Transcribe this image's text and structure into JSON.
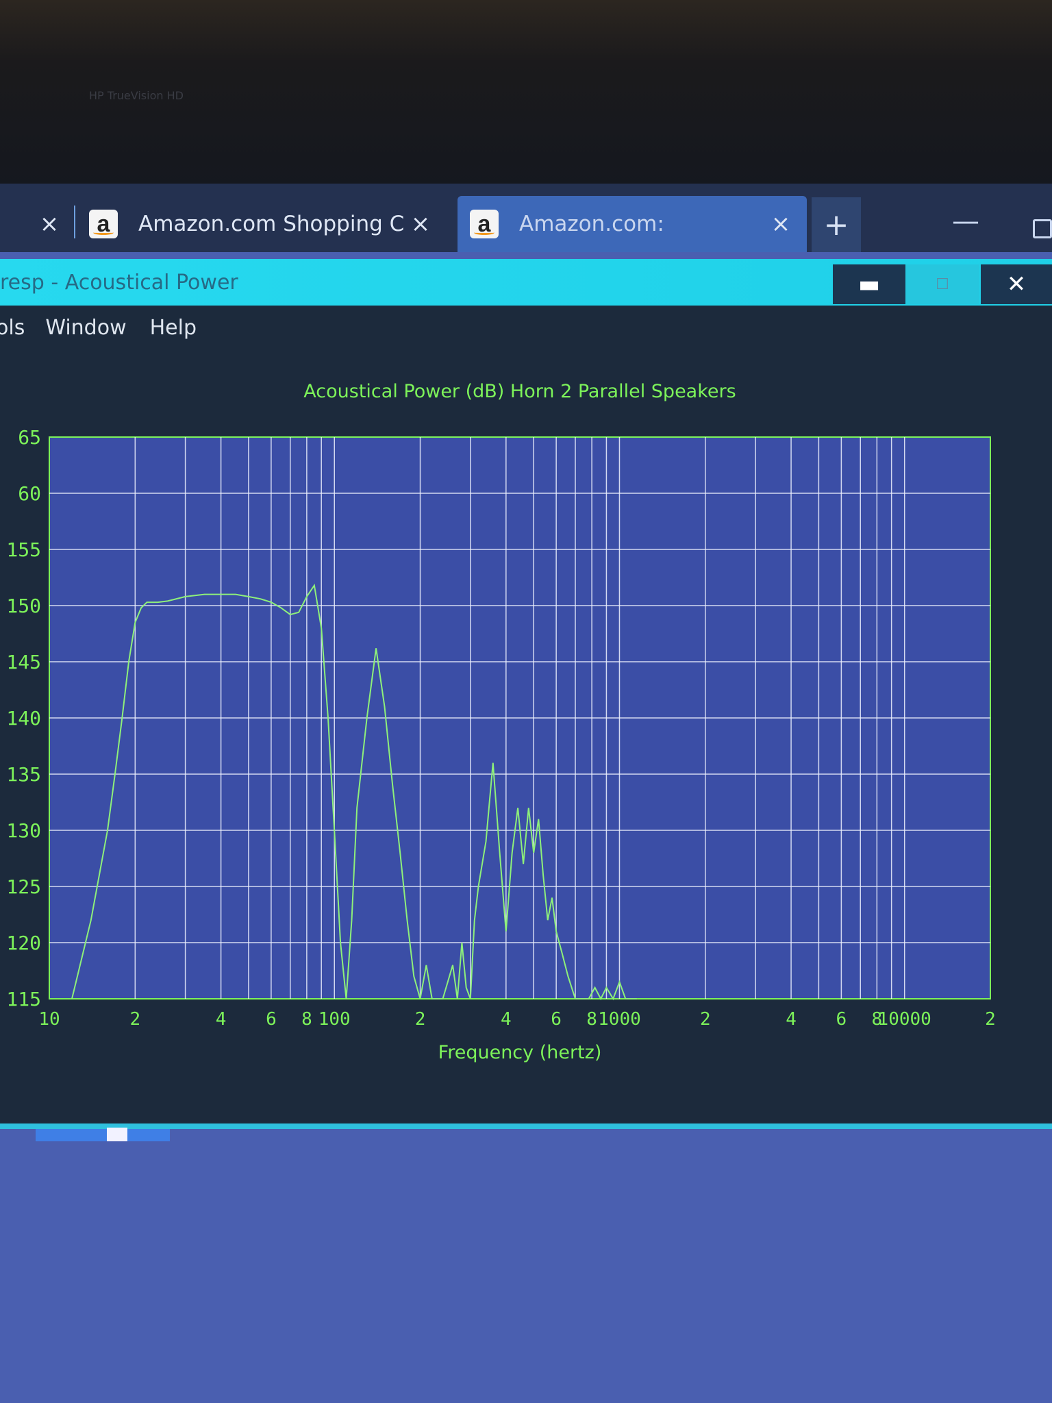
{
  "bezel": {
    "webcam_label": "HP TrueVision HD"
  },
  "browser": {
    "tabs": [
      {
        "title": "",
        "active": false
      },
      {
        "title": "Amazon.com Shopping C",
        "favicon": "amazon-icon",
        "active": false
      },
      {
        "title": "Amazon.com:",
        "favicon": "amazon-icon",
        "active": true
      }
    ],
    "favicon_letter": "a",
    "new_tab_symbol": "+",
    "close_symbol": "×",
    "minimize_symbol": "—"
  },
  "window": {
    "title": "resp - Acoustical Power",
    "minimize_symbol": "▬",
    "maximize_symbol": "☐",
    "close_symbol": "✕",
    "menu": [
      "ols",
      "Window",
      "Help"
    ]
  },
  "colors": {
    "plot_line": "#8ef07a",
    "plot_text": "#7df35a",
    "grid": "#eef2ff",
    "plot_bg": "#3b4ea6",
    "titlebar": "#22d4ec"
  },
  "chart_data": {
    "type": "line",
    "title": "Acoustical Power (dB)   Horn   2 Parallel Speakers",
    "xlabel": "Frequency (hertz)",
    "ylabel": "",
    "x_scale": "log",
    "xlim": [
      10,
      20000
    ],
    "ylim": [
      115,
      165
    ],
    "grid": true,
    "x_tick_labels": [
      {
        "value": 10,
        "label": "10"
      },
      {
        "value": 20,
        "label": "2"
      },
      {
        "value": 40,
        "label": "4"
      },
      {
        "value": 60,
        "label": "6"
      },
      {
        "value": 80,
        "label": "8"
      },
      {
        "value": 100,
        "label": "100"
      },
      {
        "value": 200,
        "label": "2"
      },
      {
        "value": 400,
        "label": "4"
      },
      {
        "value": 600,
        "label": "6"
      },
      {
        "value": 800,
        "label": "8"
      },
      {
        "value": 1000,
        "label": "1000"
      },
      {
        "value": 2000,
        "label": "2"
      },
      {
        "value": 4000,
        "label": "4"
      },
      {
        "value": 6000,
        "label": "6"
      },
      {
        "value": 8000,
        "label": "8"
      },
      {
        "value": 10000,
        "label": "10000"
      },
      {
        "value": 20000,
        "label": "2"
      }
    ],
    "y_tick_labels": [
      "65",
      "60",
      "155",
      "150",
      "145",
      "140",
      "135",
      "130",
      "125",
      "120",
      "115"
    ],
    "y_tick_values": [
      165,
      160,
      155,
      150,
      145,
      140,
      135,
      130,
      125,
      120,
      115
    ],
    "series": [
      {
        "x": [
          12,
          14,
          16,
          17,
          18,
          19,
          20,
          21,
          22,
          24,
          26,
          30,
          35,
          40,
          45,
          50,
          55,
          60,
          65,
          70,
          75,
          80,
          85,
          90,
          95,
          100,
          105,
          110,
          115,
          120,
          130,
          140,
          150,
          160,
          170,
          180,
          190,
          200,
          210,
          220,
          240,
          260,
          270,
          280,
          290,
          300,
          310,
          320,
          340,
          360,
          380,
          400,
          420,
          440,
          460,
          480,
          500,
          520,
          540,
          560,
          580,
          600,
          630,
          660,
          700,
          740,
          780,
          820,
          860,
          900,
          950,
          1000,
          1050,
          1100,
          1150
        ],
        "y": [
          115,
          122,
          130,
          135,
          140,
          145,
          148.5,
          149.8,
          150.3,
          150.3,
          150.4,
          150.8,
          151,
          151,
          151,
          150.8,
          150.6,
          150.3,
          149.8,
          149.2,
          149.4,
          150.8,
          151.8,
          148,
          140,
          130,
          120,
          115,
          122,
          132,
          140,
          146.2,
          141,
          134,
          128,
          122,
          117,
          115,
          118,
          115,
          115,
          118,
          115,
          120,
          116,
          115,
          122,
          125,
          129,
          136,
          128,
          121,
          128,
          132,
          127,
          132,
          128,
          131,
          126,
          122,
          124,
          121,
          119,
          117,
          115,
          115,
          115,
          116,
          115,
          116,
          115,
          116.5,
          115,
          115,
          115
        ]
      }
    ]
  }
}
